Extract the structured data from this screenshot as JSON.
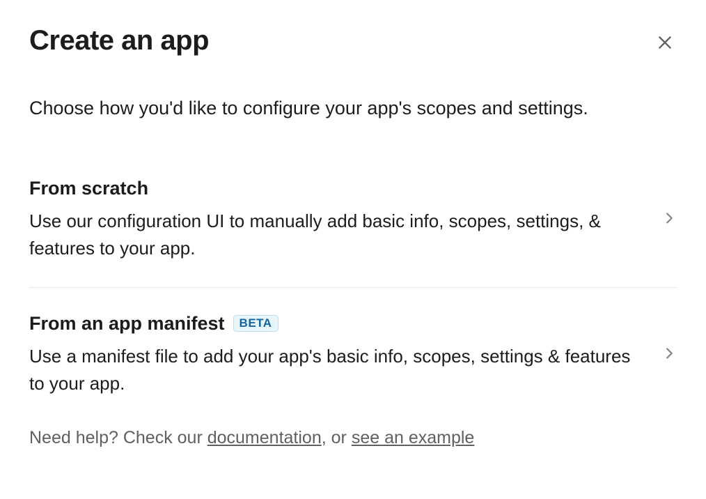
{
  "modal": {
    "title": "Create an app",
    "subtitle": "Choose how you'd like to configure your app's scopes and settings."
  },
  "options": [
    {
      "title": "From scratch",
      "description": "Use our configuration UI to manually add basic info, scopes, settings, & features to your app.",
      "badge": null
    },
    {
      "title": "From an app manifest",
      "description": "Use a manifest file to add your app's basic info, scopes, settings & features to your app.",
      "badge": "BETA"
    }
  ],
  "help": {
    "prefix": "Need help? Check our ",
    "link1": "documentation",
    "middle": ", or ",
    "link2": "see an example"
  }
}
